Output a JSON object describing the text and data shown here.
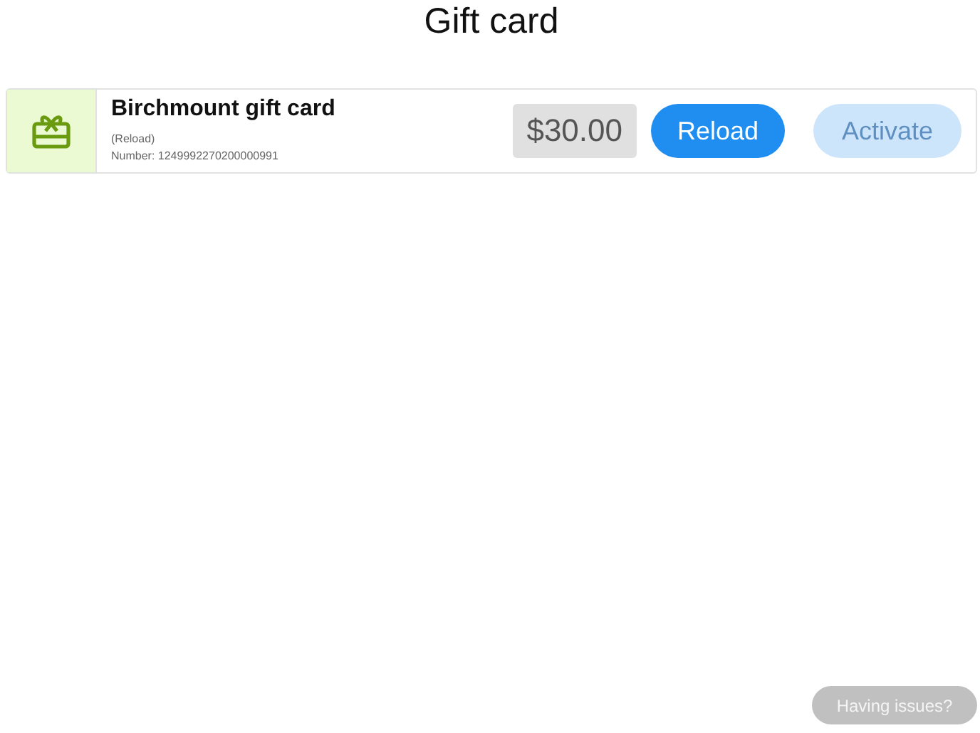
{
  "page": {
    "title": "Gift card"
  },
  "card": {
    "name": "Birchmount gift card",
    "note": "(Reload)",
    "number": "Number: 1249992270200000991",
    "amount": "$30.00",
    "buttons": [
      {
        "label": "Reload",
        "disabled": false
      },
      {
        "label": "Activate",
        "disabled": true
      }
    ]
  },
  "help_button": {
    "label": "Having issues?"
  }
}
